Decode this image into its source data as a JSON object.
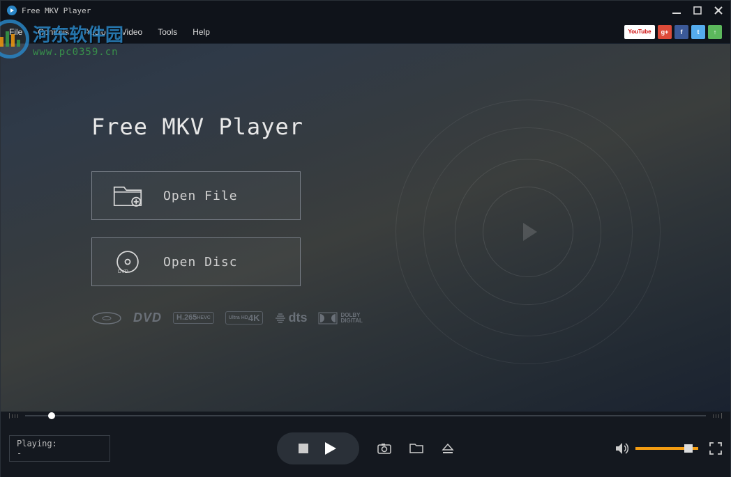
{
  "titlebar": {
    "app_name": "Free MKV Player"
  },
  "menubar": {
    "items": [
      "File",
      "Controls",
      "Audio",
      "Video",
      "Tools",
      "Help"
    ]
  },
  "watermark": {
    "cn_text": "河东软件园",
    "url_text": "www.pc0359.cn"
  },
  "main": {
    "title": "Free MKV Player",
    "open_file_label": "Open File",
    "open_disc_label": "Open Disc"
  },
  "badges": {
    "dvd": "DVD",
    "h265_line1": "H.265",
    "h265_line2": "HEVC",
    "uhd_line1": "Ultra HD",
    "uhd_line2": "4K",
    "dts": "dts",
    "dolby_line1": "DOLBY",
    "dolby_line2": "DIGITAL"
  },
  "playing": {
    "label": "Playing:",
    "value": "-"
  },
  "social": {
    "youtube": "YouTube",
    "gplus": "g+",
    "fb": "f",
    "tw": "t",
    "up": "↑"
  }
}
